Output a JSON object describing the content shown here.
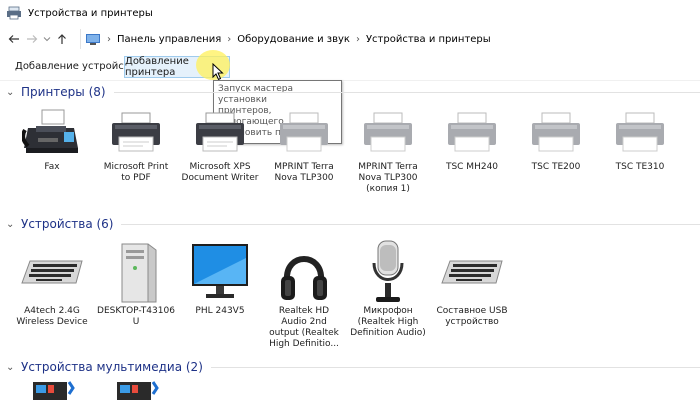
{
  "window": {
    "title": "Устройства и принтеры"
  },
  "nav": {
    "breadcrumbs": [
      "Панель управления",
      "Оборудование и звук",
      "Устройства и принтеры"
    ]
  },
  "toolbar": {
    "add_device": "Добавление устройства",
    "add_printer": "Добавление принтера"
  },
  "tooltip": {
    "lines": [
      "Запуск мастера установки",
      "принтеров, помогающего",
      "установить принтер"
    ]
  },
  "groups": {
    "printers": {
      "title": "Принтеры (8)",
      "items": [
        {
          "icon": "fax-icon",
          "lines": [
            "Fax"
          ]
        },
        {
          "icon": "printer-icon",
          "lines": [
            "Microsoft Print",
            "to PDF"
          ]
        },
        {
          "icon": "printer-icon",
          "lines": [
            "Microsoft XPS",
            "Document Writer"
          ]
        },
        {
          "icon": "printer-grey-icon",
          "lines": [
            "MPRINT Terra",
            "Nova TLP300"
          ]
        },
        {
          "icon": "printer-grey-icon",
          "lines": [
            "MPRINT Terra",
            "Nova TLP300",
            "(копия 1)"
          ]
        },
        {
          "icon": "printer-grey-icon",
          "lines": [
            "TSC MH240"
          ]
        },
        {
          "icon": "printer-grey-icon",
          "lines": [
            "TSC TE200"
          ]
        },
        {
          "icon": "printer-grey-icon",
          "lines": [
            "TSC TE310"
          ]
        }
      ]
    },
    "devices": {
      "title": "Устройства (6)",
      "items": [
        {
          "icon": "keyboard-icon",
          "lines": [
            "A4tech 2.4G",
            "Wireless Device"
          ]
        },
        {
          "icon": "computer-tower-icon",
          "lines": [
            "DESKTOP-T43106",
            "U"
          ]
        },
        {
          "icon": "monitor-icon",
          "lines": [
            "PHL 243V5"
          ]
        },
        {
          "icon": "headphones-icon",
          "lines": [
            "Realtek HD",
            "Audio 2nd",
            "output (Realtek",
            "High Definitio..."
          ]
        },
        {
          "icon": "microphone-icon",
          "lines": [
            "Микрофон",
            "(Realtek High",
            "Definition Audio)"
          ]
        },
        {
          "icon": "keyboard-icon",
          "lines": [
            "Составное USB",
            "устройство"
          ]
        }
      ]
    },
    "multimedia": {
      "title": "Устройства мультимедиа (2)",
      "items": [
        {
          "icon": "media-device-icon"
        },
        {
          "icon": "media-device-icon"
        }
      ]
    }
  },
  "colors": {
    "group_title": "#1e3287",
    "selected_button_bg": "#e5f1fb",
    "selected_button_border": "#9fcbed"
  }
}
